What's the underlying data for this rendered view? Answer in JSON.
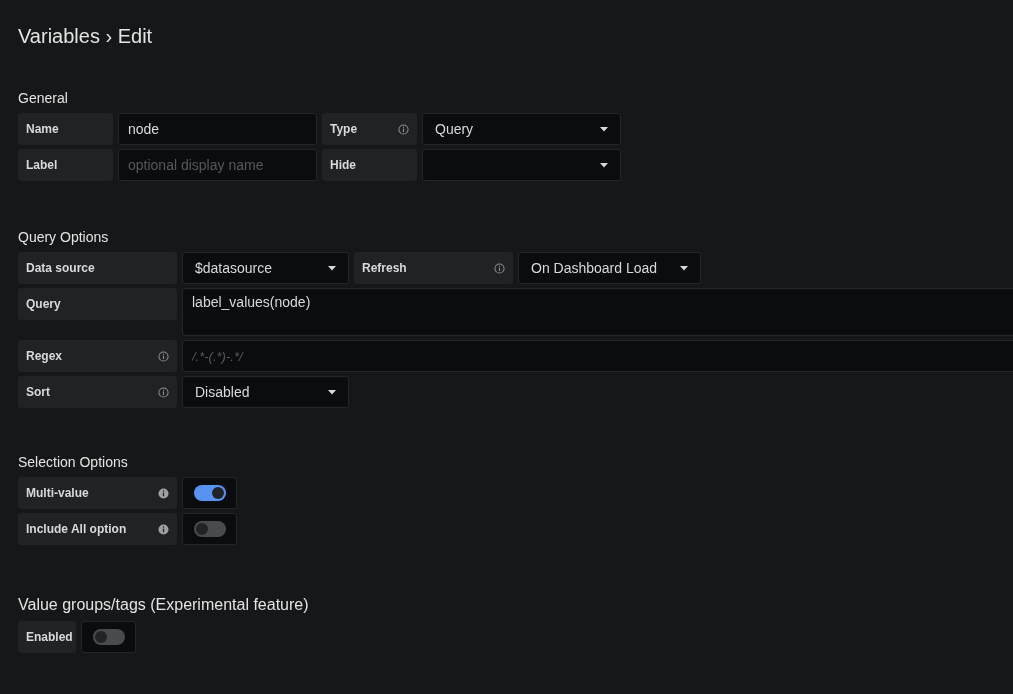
{
  "page_title": "Variables › Edit",
  "sections": [
    {
      "title": "General",
      "rows": [
        {
          "fields": [
            {
              "kind": "label",
              "text": "Name"
            },
            {
              "kind": "input",
              "value": "node"
            },
            {
              "kind": "label",
              "text": "Type",
              "info": true
            },
            {
              "kind": "select",
              "value": "Query"
            }
          ]
        },
        {
          "fields": [
            {
              "kind": "label",
              "text": "Label"
            },
            {
              "kind": "input",
              "placeholder": "optional display name"
            },
            {
              "kind": "label",
              "text": "Hide"
            },
            {
              "kind": "select"
            }
          ]
        }
      ]
    },
    {
      "title": "Query Options",
      "rows": [
        {
          "fields": [
            {
              "kind": "label",
              "text": "Data source"
            },
            {
              "kind": "select",
              "value": "$datasource"
            },
            {
              "kind": "label",
              "text": "Refresh",
              "info": true
            },
            {
              "kind": "select",
              "value": "On Dashboard Load"
            }
          ]
        },
        {
          "fields": [
            {
              "kind": "label",
              "text": "Query"
            },
            {
              "kind": "textarea",
              "value": "label_values(node)"
            }
          ]
        },
        {
          "fields": [
            {
              "kind": "label",
              "text": "Regex",
              "info": true
            },
            {
              "kind": "wide-input",
              "placeholder": "/.*-(.*)-.*/"
            }
          ]
        },
        {
          "fields": [
            {
              "kind": "label",
              "text": "Sort",
              "info": true
            },
            {
              "kind": "select",
              "value": "Disabled"
            }
          ]
        }
      ]
    },
    {
      "title": "Selection Options",
      "rows": [
        {
          "fields": [
            {
              "kind": "label",
              "text": "Multi-value",
              "info": true
            },
            {
              "kind": "toggle",
              "on": true
            }
          ]
        },
        {
          "fields": [
            {
              "kind": "label",
              "text": "Include All option",
              "info": true
            },
            {
              "kind": "toggle",
              "on": false
            }
          ]
        }
      ]
    },
    {
      "title": "Value groups/tags (Experimental feature)",
      "rows": [
        {
          "fields": [
            {
              "kind": "label",
              "text": "Enabled"
            },
            {
              "kind": "toggle",
              "on": false
            }
          ]
        }
      ]
    }
  ]
}
